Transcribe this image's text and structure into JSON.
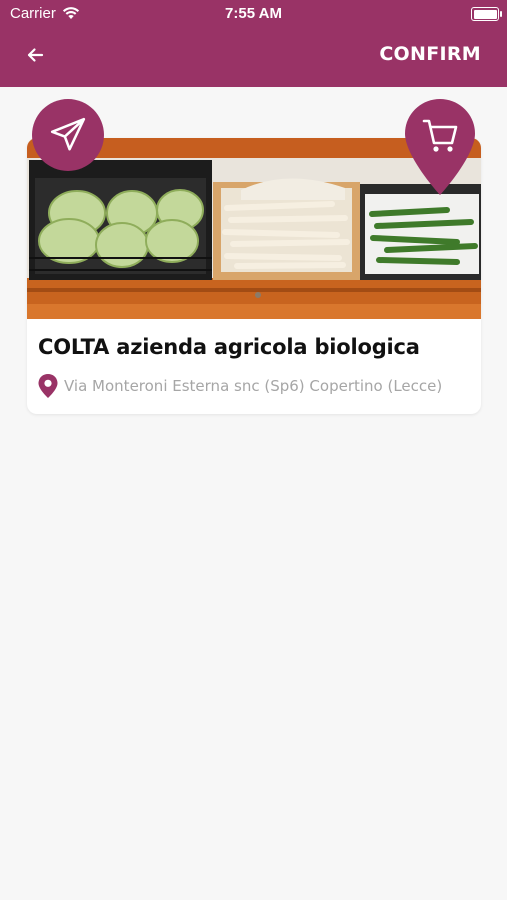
{
  "status_bar": {
    "carrier": "Carrier",
    "time": "7:55 AM"
  },
  "app_bar": {
    "back_icon": "arrow-left-icon",
    "confirm_label": "CONFIRM"
  },
  "colors": {
    "primary": "#993366",
    "background": "#f7f7f7",
    "address_text": "#a6a6a6"
  },
  "card": {
    "title": "COLTA azienda agricola biologica",
    "address": "Via Monteroni Esterna snc (Sp6) Copertino (Lecce)",
    "location_icon": "map-pin-icon"
  },
  "actions": {
    "send_icon": "paper-plane-icon",
    "cart_icon": "shopping-cart-icon"
  }
}
